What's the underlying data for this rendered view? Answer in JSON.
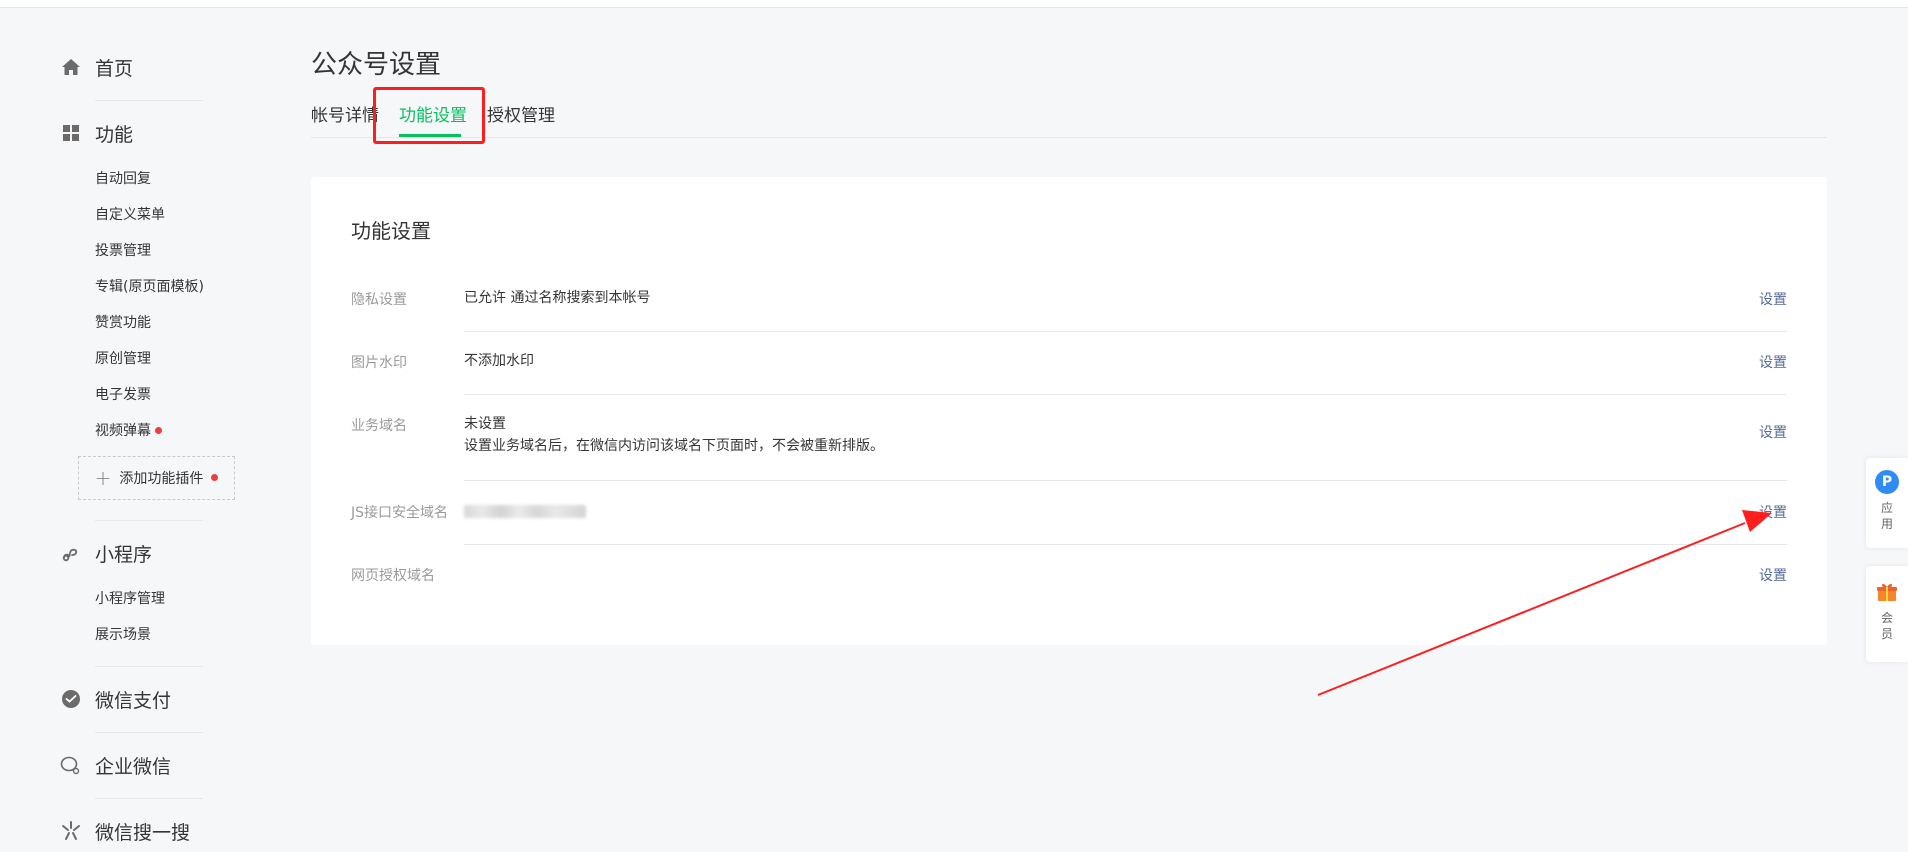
{
  "sidebar": {
    "home": "首页",
    "function": "功能",
    "function_items": [
      "自动回复",
      "自定义菜单",
      "投票管理",
      "专辑(原页面模板)",
      "赞赏功能",
      "原创管理",
      "电子发票",
      "视频弹幕"
    ],
    "add_plugin": "添加功能插件",
    "miniprogram": "小程序",
    "miniprogram_items": [
      "小程序管理",
      "展示场景"
    ],
    "wechat_pay": "微信支付",
    "work_wechat": "企业微信",
    "wechat_search": "微信搜一搜"
  },
  "main": {
    "page_title": "公众号设置",
    "tabs": [
      "帐号详情",
      "功能设置",
      "授权管理"
    ],
    "active_tab": "功能设置",
    "card_title": "功能设置",
    "rows": [
      {
        "label": "隐私设置",
        "value": "已允许 通过名称搜索到本帐号",
        "action": "设置"
      },
      {
        "label": "图片水印",
        "value": "不添加水印",
        "action": "设置"
      },
      {
        "label": "业务域名",
        "value": "未设置",
        "value2": "设置业务域名后，在微信内访问该域名下页面时，不会被重新排版。",
        "action": "设置"
      },
      {
        "label": "JS接口安全域名",
        "value": "",
        "action": "设置"
      },
      {
        "label": "网页授权域名",
        "value": "",
        "action": "设置"
      }
    ]
  },
  "float": {
    "app_icon": "P",
    "app_label": "应用",
    "member_label": "会员"
  },
  "colors": {
    "accent_green": "#07c160",
    "link_blue": "#576b95",
    "annotation_red": "#ff1e1e",
    "badge_red": "#e9403c"
  }
}
